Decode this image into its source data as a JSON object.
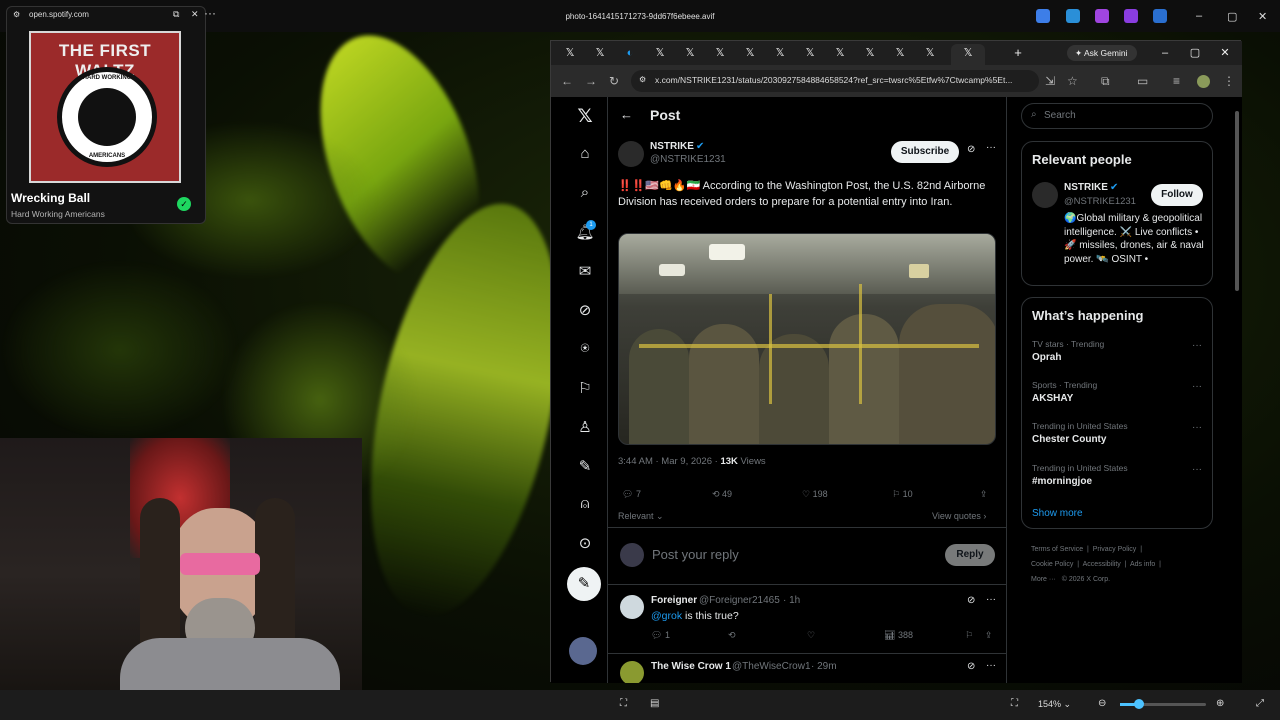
{
  "viewer": {
    "file_title": "photo-1641415171273-9dd67f6ebeee.avif",
    "zoom": "154%"
  },
  "spotify": {
    "url": "open.spotify.com",
    "album_title": "THE FIRST WALTZ",
    "album_ring_top": "HARD WORKING",
    "album_ring_bottom": "AMERICANS",
    "track": "Wrecking Ball",
    "artist": "Hard Working Americans"
  },
  "browser": {
    "url": "x.com/NSTRIKE1231/status/2030927584884658524?ref_src=twsrc%5Etfw%7Ctwcamp%5Et...",
    "gemini": "Ask Gemini",
    "tab_icons": [
      "X",
      "X",
      "bluesky",
      "X",
      "X",
      "X",
      "X",
      "X",
      "X",
      "X",
      "X",
      "X",
      "X"
    ]
  },
  "nav": {
    "notification_count": "1"
  },
  "post": {
    "header": "Post",
    "author_name": "NSTRIKE",
    "author_handle": "@NSTRIKE1231",
    "subscribe": "Subscribe",
    "text": "‼️‼️🇺🇸👊🔥🇮🇷 According to the Washington Post, the U.S. 82nd Airborne Division has received orders to prepare for a potential entry into Iran.",
    "time": "3:44 AM · Mar 9, 2026 · ",
    "views": "13K",
    "views_label": " Views",
    "replies": "7",
    "reposts": "49",
    "likes": "198",
    "bookmarks": "10",
    "relevant": "Relevant ⌄",
    "view_quotes": "View quotes ›",
    "reply_placeholder": "Post your reply",
    "reply_button": "Reply"
  },
  "replies": [
    {
      "name": "Foreigner",
      "handle": "@Foreigner21465",
      "time": "· 1h",
      "mention": "@grok",
      "text": " is this true?",
      "replies": "1",
      "views": "388"
    },
    {
      "name": "The Wise Crow 1",
      "handle": "@TheWiseCrow1",
      "time": "· 29m"
    }
  ],
  "sidebar": {
    "search_placeholder": "Search",
    "relevant_title": "Relevant people",
    "person_name": "NSTRIKE",
    "person_handle": "@NSTRIKE1231",
    "follow": "Follow",
    "bio": "🌍Global military & geopolitical intelligence. ⚔️ Live conflicts • 🚀 missiles, drones, air & naval power. 🛰️ OSINT •",
    "happening_title": "What’s happening",
    "trends": [
      {
        "meta": "TV stars · Trending",
        "name": "Oprah"
      },
      {
        "meta": "Sports · Trending",
        "name": "AKSHAY"
      },
      {
        "meta": "Trending in United States",
        "name": "Chester County"
      },
      {
        "meta": "Trending in United States",
        "name": "#morningjoe"
      }
    ],
    "show_more": "Show more",
    "footer": [
      "Terms of Service",
      "Privacy Policy",
      "Cookie Policy",
      "Accessibility",
      "Ads info",
      "More ···",
      "© 2026 X Corp."
    ]
  },
  "colors": {
    "accent": "#1d9bf0",
    "bg": "#000000",
    "spotify_green": "#1ed760"
  }
}
